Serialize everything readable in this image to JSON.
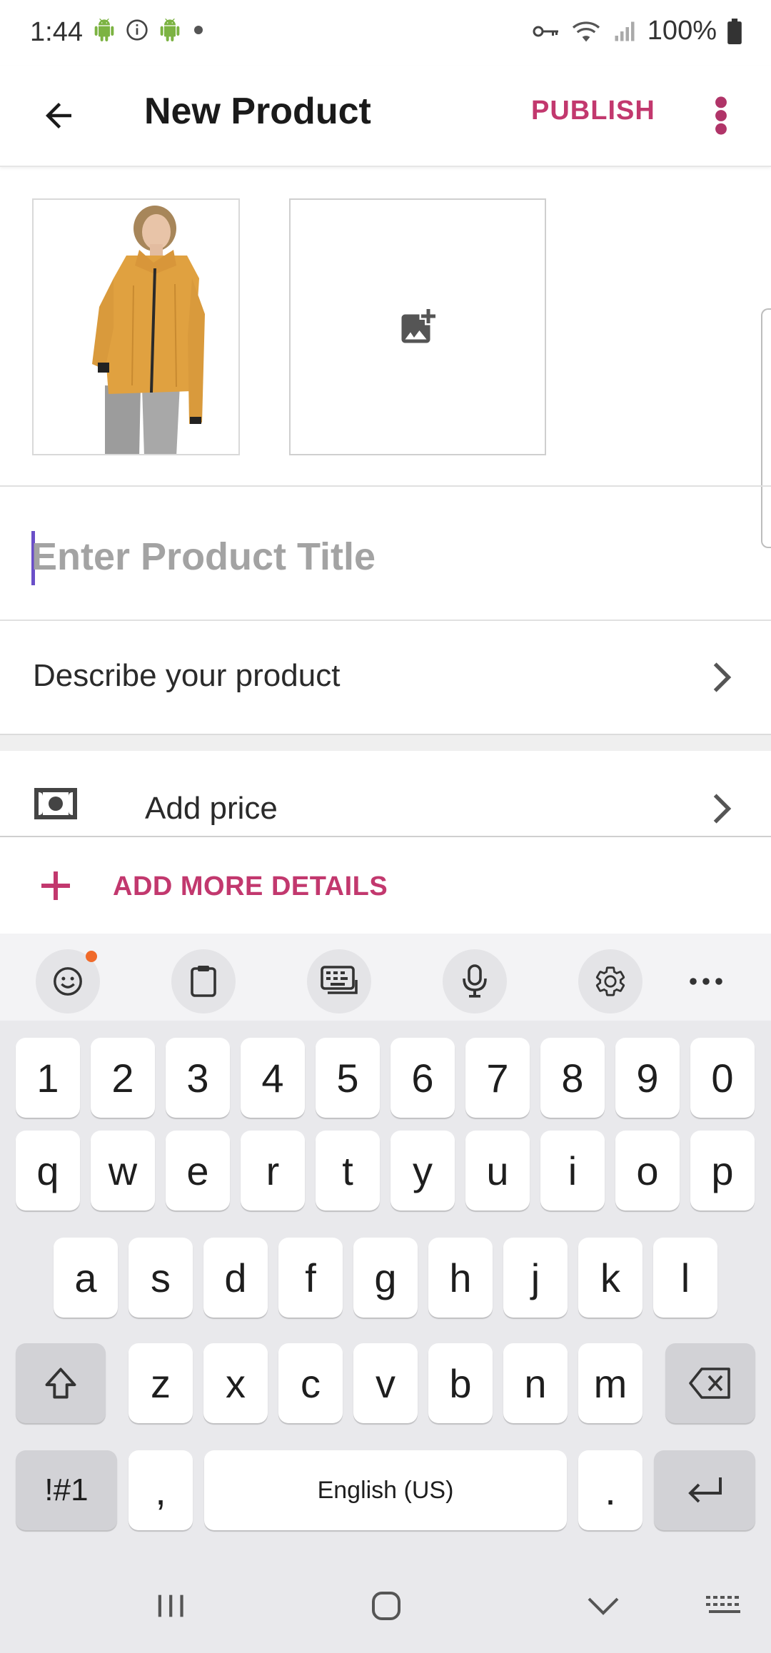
{
  "status_bar": {
    "time": "1:44",
    "battery": "100%"
  },
  "app_bar": {
    "title": "New Product",
    "publish_label": "PUBLISH"
  },
  "form": {
    "title_placeholder": "Enter Product Title",
    "title_value": "",
    "describe_label": "Describe your product",
    "price_label": "Add price",
    "more_details_label": "ADD MORE DETAILS"
  },
  "keyboard": {
    "number_row": [
      "1",
      "2",
      "3",
      "4",
      "5",
      "6",
      "7",
      "8",
      "9",
      "0"
    ],
    "row1": [
      "q",
      "w",
      "e",
      "r",
      "t",
      "y",
      "u",
      "i",
      "o",
      "p"
    ],
    "row2": [
      "a",
      "s",
      "d",
      "f",
      "g",
      "h",
      "j",
      "k",
      "l"
    ],
    "row3": [
      "z",
      "x",
      "c",
      "v",
      "b",
      "n",
      "m"
    ],
    "symbols_label": "!#1",
    "comma": ",",
    "space_label": "English (US)",
    "period": "."
  },
  "colors": {
    "accent": "#c2386e",
    "caret": "#6a4fc8",
    "notification_dot": "#f06a2a"
  }
}
